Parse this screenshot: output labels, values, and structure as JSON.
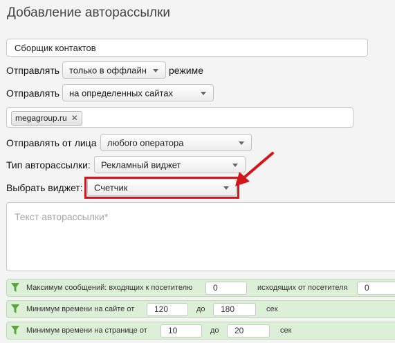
{
  "page": {
    "title": "Добавление авторассылки"
  },
  "name_field": {
    "value": "Сборщик контактов"
  },
  "row_send_mode": {
    "prefix": "Отправлять",
    "select_value": "только в оффлайн",
    "suffix": "режиме"
  },
  "row_send_sites": {
    "prefix": "Отправлять",
    "select_value": "на определенных сайтах"
  },
  "sites_tags": {
    "tag": "megagroup.ru",
    "remove_symbol": "✕"
  },
  "row_sender": {
    "label": "Отправлять от лица",
    "select_value": "любого оператора"
  },
  "row_type": {
    "label": "Тип авторассылки:",
    "select_value": "Рекламный виджет"
  },
  "row_widget": {
    "label": "Выбрать виджет:",
    "select_value": "Счетчик"
  },
  "message": {
    "placeholder": "Текст авторассылки*"
  },
  "filters": {
    "max_messages": {
      "label": "Максимум сообщений: входящих к посетителю",
      "incoming_value": "0",
      "outgoing_label": "исходящих от посетителя",
      "outgoing_value": "0"
    },
    "min_time_site": {
      "label": "Минимум времени на сайте от",
      "from_value": "120",
      "to_label": "до",
      "to_value": "180",
      "unit": "сек"
    },
    "min_time_page": {
      "label": "Минимум времени на странице от",
      "from_value": "10",
      "to_label": "до",
      "to_value": "20",
      "unit": "сек"
    }
  },
  "colors": {
    "highlight": "#d4141b",
    "arrow": "#d4141b",
    "filter_bg": "#dcefd7",
    "filter_icon": "#5aa33e"
  }
}
